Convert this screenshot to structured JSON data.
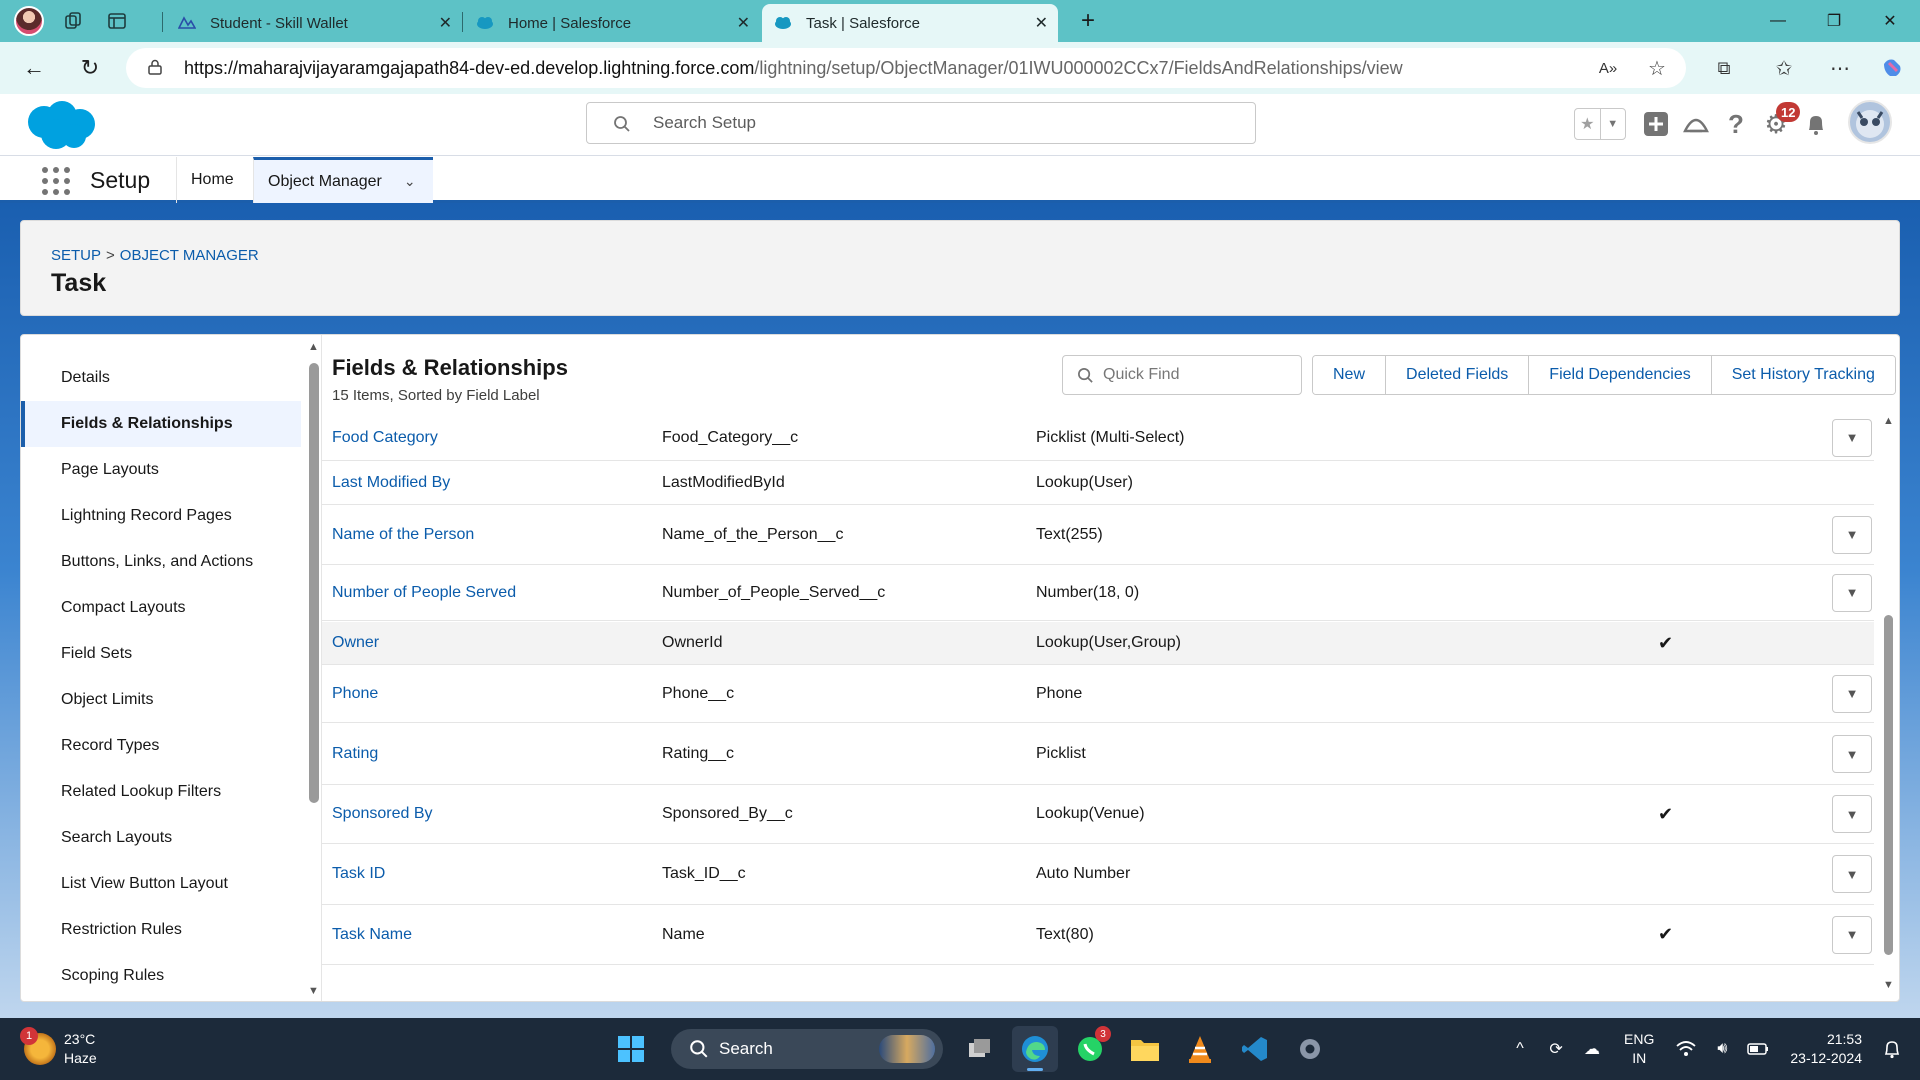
{
  "browser": {
    "tabs": [
      {
        "title": "Student - Skill Wallet"
      },
      {
        "title": "Home | Salesforce"
      },
      {
        "title": "Task | Salesforce"
      }
    ],
    "url_host": "https://maharajvijayaramgajapath84-dev-ed.develop.lightning.force.com",
    "url_path": "/lightning/setup/ObjectManager/01IWU000002CCx7/FieldsAndRelationships/view"
  },
  "header": {
    "search_placeholder": "Search Setup",
    "notification_count": "12"
  },
  "appnav": {
    "app_name": "Setup",
    "tabs": [
      {
        "label": "Home"
      },
      {
        "label": "Object Manager"
      }
    ]
  },
  "page_header": {
    "breadcrumb": [
      "SETUP",
      "OBJECT MANAGER"
    ],
    "title": "Task"
  },
  "sidebar": {
    "items": [
      {
        "label": "Details"
      },
      {
        "label": "Fields & Relationships"
      },
      {
        "label": "Page Layouts"
      },
      {
        "label": "Lightning Record Pages"
      },
      {
        "label": "Buttons, Links, and Actions"
      },
      {
        "label": "Compact Layouts"
      },
      {
        "label": "Field Sets"
      },
      {
        "label": "Object Limits"
      },
      {
        "label": "Record Types"
      },
      {
        "label": "Related Lookup Filters"
      },
      {
        "label": "Search Layouts"
      },
      {
        "label": "List View Button Layout"
      },
      {
        "label": "Restriction Rules"
      },
      {
        "label": "Scoping Rules"
      }
    ]
  },
  "main": {
    "title": "Fields & Relationships",
    "subtitle": "15 Items, Sorted by Field Label",
    "quick_find_placeholder": "Quick Find",
    "buttons": [
      {
        "label": "New"
      },
      {
        "label": "Deleted Fields"
      },
      {
        "label": "Field Dependencies"
      },
      {
        "label": "Set History Tracking"
      }
    ],
    "rows": [
      {
        "label": "Food Category",
        "api": "Food_Category__c",
        "type": "Picklist (Multi-Select)",
        "indexed": false,
        "menu": true
      },
      {
        "label": "Last Modified By",
        "api": "LastModifiedById",
        "type": "Lookup(User)",
        "indexed": false,
        "menu": false
      },
      {
        "label": "Name of the Person",
        "api": "Name_of_the_Person__c",
        "type": "Text(255)",
        "indexed": false,
        "menu": true
      },
      {
        "label": "Number of People Served",
        "api": "Number_of_People_Served__c",
        "type": "Number(18, 0)",
        "indexed": false,
        "menu": true
      },
      {
        "label": "Owner",
        "api": "OwnerId",
        "type": "Lookup(User,Group)",
        "indexed": true,
        "menu": false
      },
      {
        "label": "Phone",
        "api": "Phone__c",
        "type": "Phone",
        "indexed": false,
        "menu": true
      },
      {
        "label": "Rating",
        "api": "Rating__c",
        "type": "Picklist",
        "indexed": false,
        "menu": true
      },
      {
        "label": "Sponsored By",
        "api": "Sponsored_By__c",
        "type": "Lookup(Venue)",
        "indexed": true,
        "menu": true
      },
      {
        "label": "Task ID",
        "api": "Task_ID__c",
        "type": "Auto Number",
        "indexed": false,
        "menu": true
      },
      {
        "label": "Task Name",
        "api": "Name",
        "type": "Text(80)",
        "indexed": true,
        "menu": true
      }
    ]
  },
  "taskbar": {
    "weather_temp": "23°C",
    "weather_desc": "Haze",
    "weather_badge": "1",
    "search_label": "Search",
    "whatsapp_badge": "3",
    "lang_line1": "ENG",
    "lang_line2": "IN",
    "time": "21:53",
    "date": "23-12-2024"
  },
  "colors": {
    "link": "#0b5cab",
    "brand": "#1b5eab",
    "tabbar": "#5dc2c6"
  }
}
